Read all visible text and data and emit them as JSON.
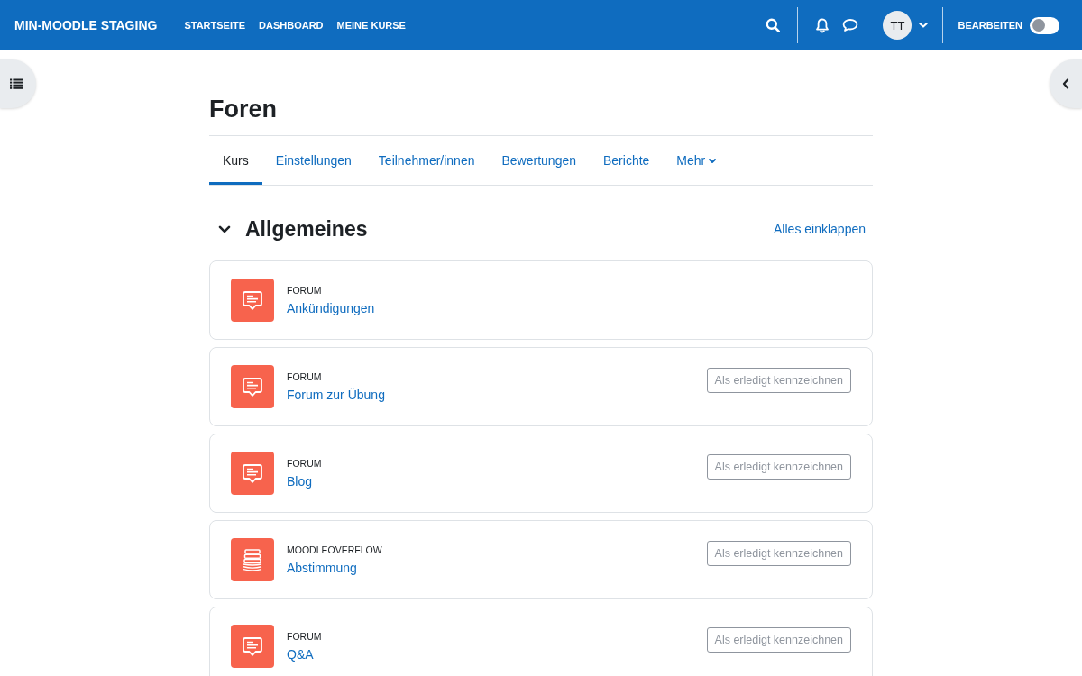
{
  "navbar": {
    "brand": "MIN-MOODLE STAGING",
    "links": [
      "STARTSEITE",
      "DASHBOARD",
      "MEINE KURSE"
    ],
    "avatar": "TT",
    "edit_mode": {
      "label": "BEARBEITEN",
      "on": false
    }
  },
  "page_title": "Foren",
  "tabs": [
    {
      "label": "Kurs",
      "selected": true,
      "kind": "link"
    },
    {
      "label": "Einstellungen",
      "selected": false,
      "kind": "link"
    },
    {
      "label": "Teilnehmer/innen",
      "selected": false,
      "kind": "link"
    },
    {
      "label": "Bewertungen",
      "selected": false,
      "kind": "link"
    },
    {
      "label": "Berichte",
      "selected": false,
      "kind": "link"
    },
    {
      "label": "Mehr",
      "selected": false,
      "kind": "menu"
    }
  ],
  "section": {
    "title": "Allgemeines",
    "expanded": true,
    "collapse_all": "Alles einklappen",
    "activities": [
      {
        "kind": "forum",
        "type": "FORUM",
        "name": "Ankündigungen"
      },
      {
        "kind": "forum",
        "type": "FORUM",
        "name": "Forum zur Übung",
        "completion": "Als erledigt kennzeichnen"
      },
      {
        "kind": "forum",
        "type": "FORUM",
        "name": "Blog",
        "completion": "Als erledigt kennzeichnen"
      },
      {
        "kind": "moodleoverflow",
        "type": "MOODLEOVERFLOW",
        "name": "Abstimmung",
        "completion": "Als erledigt kennzeichnen"
      },
      {
        "kind": "forum",
        "type": "FORUM",
        "name": "Q&A",
        "completion": "Als erledigt kennzeichnen"
      }
    ]
  }
}
